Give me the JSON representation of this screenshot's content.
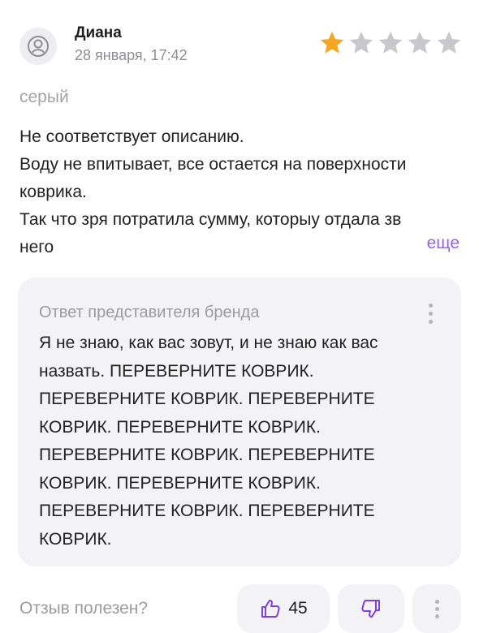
{
  "review": {
    "author": "Диана",
    "date": "28 января, 17:42",
    "rating": 1,
    "rating_max": 5,
    "variant": "серый",
    "text_lines": [
      "Не соответствует описанию.",
      "Воду не впитывает, все остается на поверхности коврика.",
      "Так что зря потратила сумму, которыу отдала зв него"
    ],
    "more_label": "еще"
  },
  "reply": {
    "title": "Ответ представителя бренда",
    "text": "Я не знаю, как вас зовут, и не знаю как вас назвать. ПЕРЕВЕРНИТЕ КОВРИК. ПЕРЕВЕРНИТЕ КОВРИК. ПЕРЕВЕРНИТЕ КОВРИК. ПЕРЕВЕРНИТЕ КОВРИК. ПЕРЕВЕРНИТЕ КОВРИК. ПЕРЕВЕРНИТЕ КОВРИК. ПЕРЕВЕРНИТЕ КОВРИК. ПЕРЕВЕРНИТЕ КОВРИК. ПЕРЕВЕРНИТЕ КОВРИК."
  },
  "footer": {
    "question": "Отзыв полезен?",
    "likes": "45"
  },
  "colors": {
    "star_filled": "#f5a623",
    "star_empty": "#c7c7cc",
    "accent": "#9b5cf6",
    "like_icon": "#7b3fe4"
  },
  "icons": {
    "avatar": "user-avatar-icon",
    "like": "thumbs-up-icon",
    "dislike": "thumbs-down-icon",
    "menu": "vertical-dots-icon"
  }
}
